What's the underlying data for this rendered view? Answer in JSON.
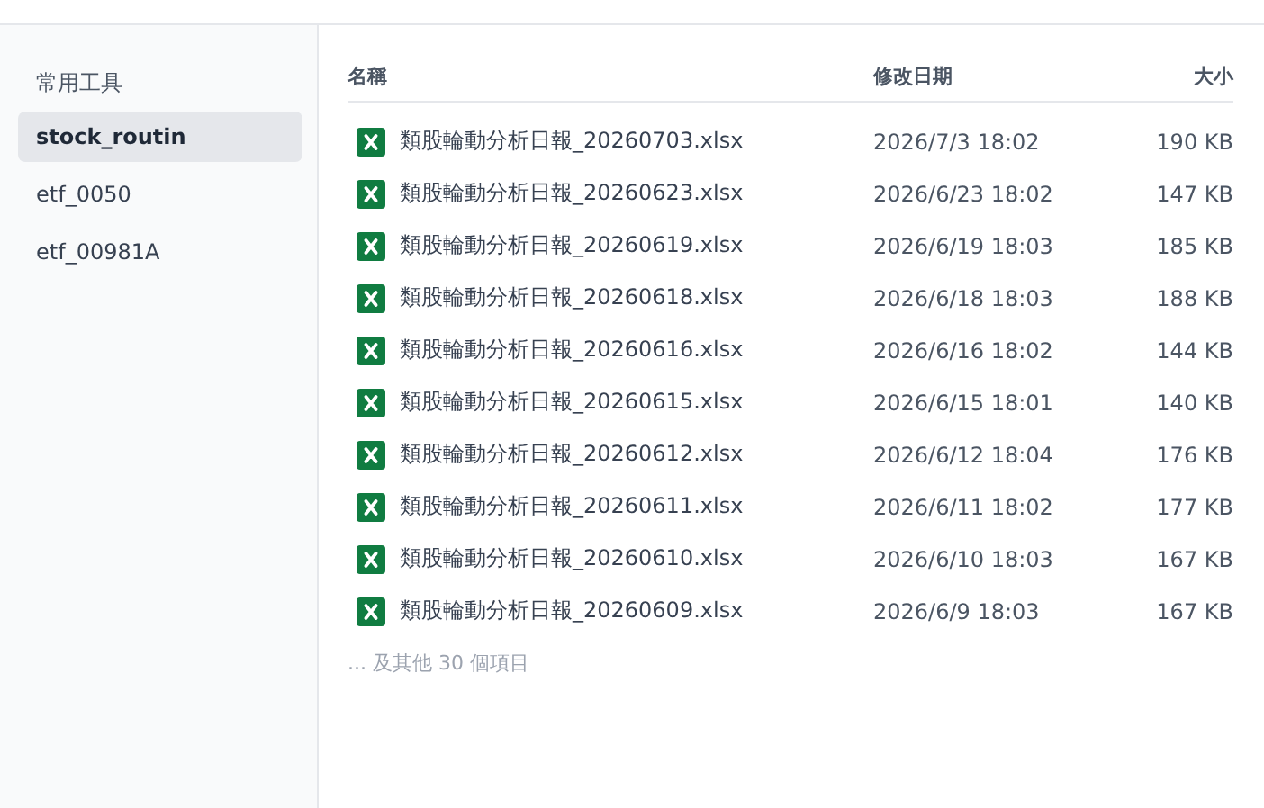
{
  "sidebar": {
    "heading": "常用工具",
    "items": [
      {
        "label": "stock_routin",
        "selected": true
      },
      {
        "label": "etf_0050",
        "selected": false
      },
      {
        "label": "etf_00981A",
        "selected": false
      }
    ]
  },
  "table": {
    "columns": [
      "名稱",
      "修改日期",
      "大小"
    ],
    "rows": [
      {
        "name": "類股輪動分析日報_20260703.xlsx",
        "modified": "2026/7/3 18:02",
        "size": "190 KB"
      },
      {
        "name": "類股輪動分析日報_20260623.xlsx",
        "modified": "2026/6/23 18:02",
        "size": "147 KB"
      },
      {
        "name": "類股輪動分析日報_20260619.xlsx",
        "modified": "2026/6/19 18:03",
        "size": "185 KB"
      },
      {
        "name": "類股輪動分析日報_20260618.xlsx",
        "modified": "2026/6/18 18:03",
        "size": "188 KB"
      },
      {
        "name": "類股輪動分析日報_20260616.xlsx",
        "modified": "2026/6/16 18:02",
        "size": "144 KB"
      },
      {
        "name": "類股輪動分析日報_20260615.xlsx",
        "modified": "2026/6/15 18:01",
        "size": "140 KB"
      },
      {
        "name": "類股輪動分析日報_20260612.xlsx",
        "modified": "2026/6/12 18:04",
        "size": "176 KB"
      },
      {
        "name": "類股輪動分析日報_20260611.xlsx",
        "modified": "2026/6/11 18:02",
        "size": "177 KB"
      },
      {
        "name": "類股輪動分析日報_20260610.xlsx",
        "modified": "2026/6/10 18:03",
        "size": "167 KB"
      },
      {
        "name": "類股輪動分析日報_20260609.xlsx",
        "modified": "2026/6/9 18:03",
        "size": "167 KB"
      }
    ],
    "more": "... 及其他 30 個項目"
  }
}
